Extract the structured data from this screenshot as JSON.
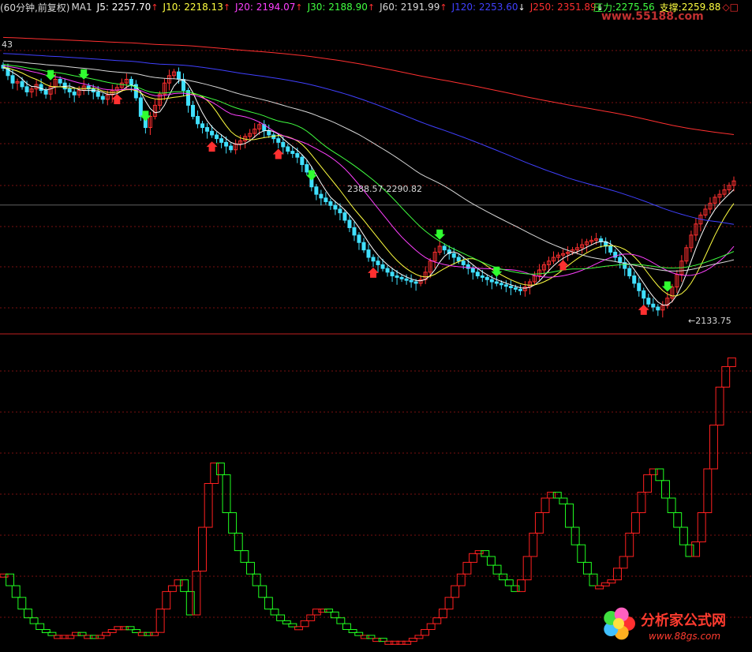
{
  "header": {
    "title": "(60分钟,前复权)",
    "indicator": "MA1",
    "items": [
      {
        "label": "J5:",
        "value": "2257.70",
        "dir": "↑",
        "color": "#ffffff"
      },
      {
        "label": "J10:",
        "value": "2218.13",
        "dir": "↑",
        "color": "#ffff40"
      },
      {
        "label": "J20:",
        "value": "2194.07",
        "dir": "↑",
        "color": "#ff40ff"
      },
      {
        "label": "J30:",
        "value": "2188.90",
        "dir": "↑",
        "color": "#40ff40"
      },
      {
        "label": "J60:",
        "value": "2191.99",
        "dir": "↑",
        "color": "#d8d8d8"
      },
      {
        "label": "J120:",
        "value": "2253.60",
        "dir": "↓",
        "color": "#4040ff"
      },
      {
        "label": "J250:",
        "value": "2351.89",
        "dir": "↓",
        "color": "#ff3030"
      }
    ],
    "pressure_label": "压力:",
    "pressure_value": "2275.56",
    "support_label": "支撑:",
    "support_value": "2259.88",
    "corner_glyphs": "◇□"
  },
  "watermark_top": "www.55188.com",
  "watermark_bottom": {
    "title": "分析家公式网",
    "url": "www.88gs.com"
  },
  "chart_data": [
    {
      "type": "candlestick",
      "title": "",
      "annotations": {
        "left_edge_value": "43",
        "range_label": "2388.57-2290.82",
        "low_label": "←2133.75"
      },
      "pressure_level": 2275.56,
      "ylim": [
        2105,
        2520
      ],
      "bars": 155,
      "closes": [
        2460,
        2450,
        2440,
        2442,
        2435,
        2428,
        2432,
        2438,
        2430,
        2425,
        2435,
        2445,
        2440,
        2432,
        2428,
        2424,
        2430,
        2436,
        2432,
        2428,
        2422,
        2418,
        2424,
        2430,
        2434,
        2440,
        2445,
        2438,
        2420,
        2395,
        2380,
        2395,
        2410,
        2425,
        2440,
        2450,
        2455,
        2445,
        2430,
        2410,
        2395,
        2385,
        2380,
        2375,
        2370,
        2365,
        2360,
        2355,
        2350,
        2358,
        2362,
        2368,
        2372,
        2378,
        2384,
        2376,
        2370,
        2365,
        2360,
        2354,
        2348,
        2345,
        2340,
        2330,
        2320,
        2300,
        2290,
        2285,
        2280,
        2275,
        2270,
        2265,
        2255,
        2245,
        2235,
        2225,
        2215,
        2205,
        2200,
        2195,
        2190,
        2185,
        2180,
        2178,
        2176,
        2174,
        2172,
        2170,
        2175,
        2185,
        2200,
        2212,
        2220,
        2215,
        2210,
        2205,
        2200,
        2195,
        2190,
        2185,
        2180,
        2178,
        2175,
        2172,
        2170,
        2168,
        2166,
        2164,
        2162,
        2160,
        2165,
        2172,
        2180,
        2188,
        2195,
        2200,
        2205,
        2208,
        2210,
        2212,
        2215,
        2218,
        2222,
        2226,
        2228,
        2230,
        2226,
        2220,
        2212,
        2205,
        2198,
        2190,
        2180,
        2170,
        2160,
        2150,
        2142,
        2138,
        2134,
        2140,
        2150,
        2165,
        2182,
        2200,
        2218,
        2235,
        2250,
        2262,
        2270,
        2278,
        2286,
        2290,
        2296,
        2302,
        2308
      ],
      "ma": [
        {
          "name": "J5",
          "color": "#ffffff",
          "period": 5
        },
        {
          "name": "J10",
          "color": "#ffff40",
          "period": 10
        },
        {
          "name": "J20",
          "color": "#ff40ff",
          "period": 20
        },
        {
          "name": "J30",
          "color": "#40ff40",
          "period": 30
        },
        {
          "name": "J60",
          "color": "#d8d8d8",
          "period": 60
        },
        {
          "name": "J120",
          "color": "#4040ff",
          "period": 120
        },
        {
          "name": "J250",
          "color": "#ff3030",
          "period": 250
        }
      ]
    },
    {
      "type": "step-boxes",
      "ylim": [
        0,
        100
      ],
      "values": [
        24,
        20,
        16,
        12,
        9,
        7,
        5,
        4,
        3,
        3,
        3,
        3,
        4,
        3,
        3,
        2,
        3,
        4,
        5,
        6,
        6,
        5,
        4,
        4,
        3,
        4,
        12,
        18,
        20,
        22,
        18,
        10,
        25,
        40,
        55,
        62,
        58,
        45,
        38,
        32,
        28,
        24,
        20,
        16,
        12,
        10,
        8,
        7,
        6,
        6,
        8,
        10,
        12,
        12,
        11,
        9,
        7,
        5,
        4,
        3,
        3,
        2,
        2,
        1,
        1,
        1,
        1,
        1,
        2,
        3,
        5,
        7,
        9,
        12,
        16,
        20,
        24,
        28,
        31,
        32,
        30,
        27,
        24,
        22,
        20,
        18,
        22,
        30,
        38,
        45,
        50,
        52,
        50,
        48,
        40,
        34,
        28,
        24,
        20,
        20,
        21,
        22,
        26,
        30,
        38,
        45,
        52,
        58,
        60,
        56,
        50,
        45,
        40,
        34,
        30,
        35,
        45,
        60,
        75,
        88,
        95,
        98
      ],
      "colors": {
        "up": "#ff2020",
        "down": "#20ff20"
      }
    }
  ]
}
